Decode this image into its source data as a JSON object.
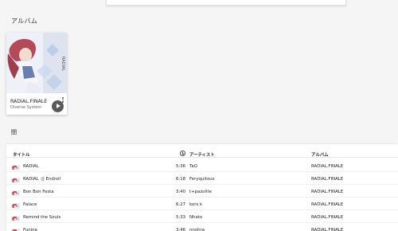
{
  "section_title": "アルバム",
  "album_card": {
    "title": "RADIAL.FINALE",
    "artist": "Diverse System"
  },
  "table": {
    "headers": {
      "title": "タイトル",
      "artist": "アーティスト",
      "album": "アルバム"
    },
    "rows": [
      {
        "title": "RADIAL",
        "duration": "5:36",
        "artist": "TaQ",
        "album": "RADIAL.FINALE"
      },
      {
        "title": "RADIAL :|| Endroll",
        "duration": "6:18",
        "artist": "Feryquitous",
        "album": "RADIAL.FINALE"
      },
      {
        "title": "Bon Bon Festa",
        "duration": "3:40",
        "artist": "t+pazolite",
        "album": "RADIAL.FINALE"
      },
      {
        "title": "Palace",
        "duration": "6:27",
        "artist": "kors k",
        "album": "RADIAL.FINALE"
      },
      {
        "title": "Remind the Souls",
        "duration": "5:33",
        "artist": "Nhato",
        "album": "RADIAL.FINALE"
      },
      {
        "title": "Funina",
        "duration": "3:46",
        "artist": "nnohra",
        "album": "RADIAL.FINALE"
      }
    ]
  },
  "icons": {
    "play": "play-icon",
    "menu": "more-vert-icon",
    "grid": "grid-view-icon",
    "clock": "clock-icon"
  }
}
